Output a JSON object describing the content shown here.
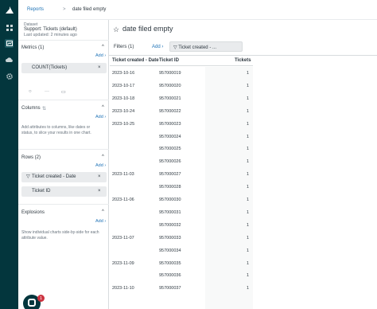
{
  "breadcrumb": {
    "parent": "Reports",
    "separator": ">",
    "current": "date filed empty"
  },
  "nav": {
    "icons": [
      "zendesk-logo-icon",
      "grid-icon",
      "chart-icon",
      "cloud-icon",
      "gear-icon"
    ]
  },
  "dataset": {
    "label": "Dataset",
    "name": "Support: Tickets (default)",
    "updated": "Last updated: 2 minutes ago"
  },
  "metrics": {
    "title": "Metrics (1)",
    "add": "Add ›",
    "items": [
      "COUNT(Tickets)"
    ]
  },
  "columns": {
    "title": "Columns",
    "add": "Add ›",
    "help": "Add attributes to columns, like dates or status, to slice your results in one chart."
  },
  "rows": {
    "title": "Rows (2)",
    "add": "Add ›",
    "items": [
      "Ticket created - Date",
      "Ticket ID"
    ]
  },
  "explosions": {
    "title": "Explosions",
    "add": "Add ›",
    "help": "Show individual charts side-by-side for each attribute value."
  },
  "report": {
    "title": "date filed empty",
    "filters_label": "Filters (1)",
    "filters_add": "Add ›",
    "filter_chip": "Ticket created - ..."
  },
  "table": {
    "headers": [
      "Ticket created - Date",
      "Ticket ID",
      "Tickets"
    ],
    "rows": [
      {
        "date": "2023-10-16",
        "id": "957000019",
        "count": "1"
      },
      {
        "date": "2023-10-17",
        "id": "957000020",
        "count": "1"
      },
      {
        "date": "2023-10-18",
        "id": "957000021",
        "count": "1"
      },
      {
        "date": "2023-10-24",
        "id": "957000022",
        "count": "1"
      },
      {
        "date": "2023-10-25",
        "id": "957000023",
        "count": "1"
      },
      {
        "date": "",
        "id": "957000024",
        "count": "1"
      },
      {
        "date": "",
        "id": "957000025",
        "count": "1"
      },
      {
        "date": "",
        "id": "957000026",
        "count": "1"
      },
      {
        "date": "2023-11-03",
        "id": "957000027",
        "count": "1"
      },
      {
        "date": "",
        "id": "957000028",
        "count": "1"
      },
      {
        "date": "2023-11-06",
        "id": "957000030",
        "count": "1"
      },
      {
        "date": "",
        "id": "957000031",
        "count": "1"
      },
      {
        "date": "",
        "id": "957000032",
        "count": "1"
      },
      {
        "date": "2023-11-07",
        "id": "957000033",
        "count": "1"
      },
      {
        "date": "",
        "id": "957000034",
        "count": "1"
      },
      {
        "date": "2023-11-09",
        "id": "957000035",
        "count": "1"
      },
      {
        "date": "",
        "id": "957000036",
        "count": "1"
      },
      {
        "date": "2023-11-10",
        "id": "957000037",
        "count": "1"
      }
    ]
  },
  "notifications": {
    "badge": "1"
  },
  "colors": {
    "nav_bg": "#03363d",
    "link": "#1f73b7",
    "badge": "#cc3340"
  }
}
